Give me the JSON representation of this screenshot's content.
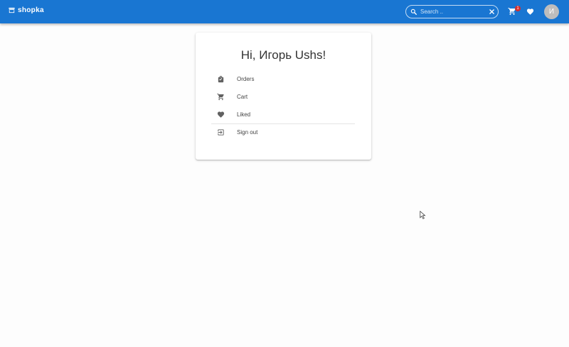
{
  "appbar": {
    "brand_name": "shopka",
    "search": {
      "placeholder": "Search ..",
      "value": ""
    },
    "cart_badge_count": "1",
    "avatar_initial": "И"
  },
  "colors": {
    "primary": "#1976d2",
    "badge": "#d32f2f",
    "avatar": "#bdbdbd"
  },
  "account_card": {
    "greeting": "Hi, Игорь Ushs!",
    "menu": [
      {
        "label": "Orders",
        "icon": "shopping-bag-icon"
      },
      {
        "label": "Cart",
        "icon": "cart-icon"
      },
      {
        "label": "Liked",
        "icon": "heart-icon"
      },
      {
        "label": "Sign out",
        "icon": "sign-out-icon"
      }
    ]
  }
}
